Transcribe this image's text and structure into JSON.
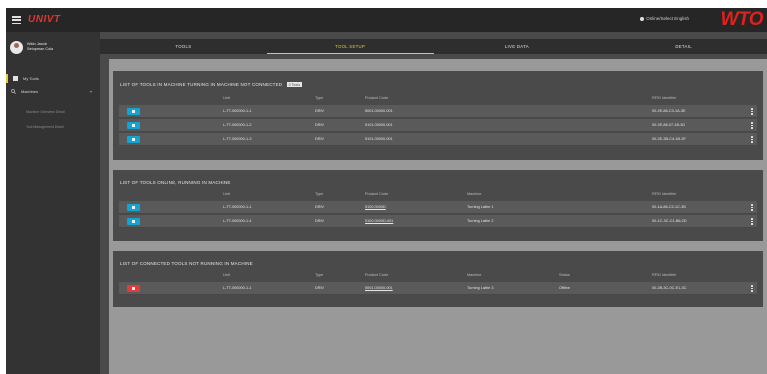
{
  "header": {
    "app_title": "UNIVT",
    "user_status": "Online/Select English",
    "logo_text": "WTO"
  },
  "sidebar": {
    "profile": {
      "name": "Wido Jacob",
      "role": "Setupman Cola"
    },
    "items": [
      {
        "label": "My Tools",
        "icon": "grid-icon",
        "active": true
      },
      {
        "label": "Machines",
        "icon": "search-icon",
        "active": false
      }
    ],
    "sub_items": [
      "Machine Overview Detail",
      "Tool Management Detail"
    ]
  },
  "tabs": [
    {
      "label": "TOOLS",
      "active": false
    },
    {
      "label": "TOOL SETUP",
      "active": true
    },
    {
      "label": "LIVE DATA",
      "active": false
    },
    {
      "label": "DETAIL",
      "active": false
    }
  ],
  "panels": [
    {
      "title": "LIST OF TOOLS IN MACHINE TURNING IN MACHINE NOT CONNECTED",
      "badge": "0 Tools",
      "columns": [
        "Unit",
        "Type",
        "Product Code",
        "RFID Identifier"
      ],
      "rows": [
        {
          "button_color": "blue",
          "cells": [
            "L-TT-000000-1-1",
            "DRIV",
            "5001.00000-001",
            "00-2E-88-C3-1A-3E"
          ]
        },
        {
          "button_color": "blue",
          "cells": [
            "L-TT-000000-1-2",
            "DRIV",
            "5101.00000-001",
            "00-2E-88-07-1B-3D"
          ]
        },
        {
          "button_color": "blue",
          "cells": [
            "L-TT-000000-1-3",
            "DRIV",
            "5101.00000-001",
            "00-2E-3B-C4-1B-3F"
          ]
        }
      ]
    },
    {
      "title": "LIST OF TOOLS ONLINE, RUNNING IN MACHINE",
      "columns": [
        "Unit",
        "Type",
        "Product Code",
        "Machine",
        "RFID Identifier"
      ],
      "rows": [
        {
          "button_color": "blue",
          "cells": [
            "L-TT-000000-1-1",
            "DRIV",
            "5100.0000D",
            "Turning Lathe 1",
            "00-1A-86-C2-1C-3B"
          ]
        },
        {
          "button_color": "blue",
          "cells": [
            "L-TT-000000-1-4",
            "DRIV",
            "5100.0000D-001",
            "Turning Lathe 2",
            "00-1C-3C-C1-B6-2D"
          ]
        }
      ]
    },
    {
      "title": "LIST OF CONNECTED TOOLS NOT RUNNING IN MACHINE",
      "columns": [
        "Unit",
        "Type",
        "Product Code",
        "Machine",
        "Status",
        "RFID Identifier"
      ],
      "rows": [
        {
          "button_color": "red",
          "cells": [
            "L-TT-000000-1-1",
            "DRIV",
            "5001.00000-001",
            "Turning Lathe 3",
            "Offline",
            "00-2B-3C-0C-E1-3C"
          ]
        }
      ]
    }
  ],
  "colors": {
    "accent": "#e8c640",
    "brand": "#e4201c",
    "button_blue": "#15a3d1",
    "button_red": "#e43a3a"
  }
}
